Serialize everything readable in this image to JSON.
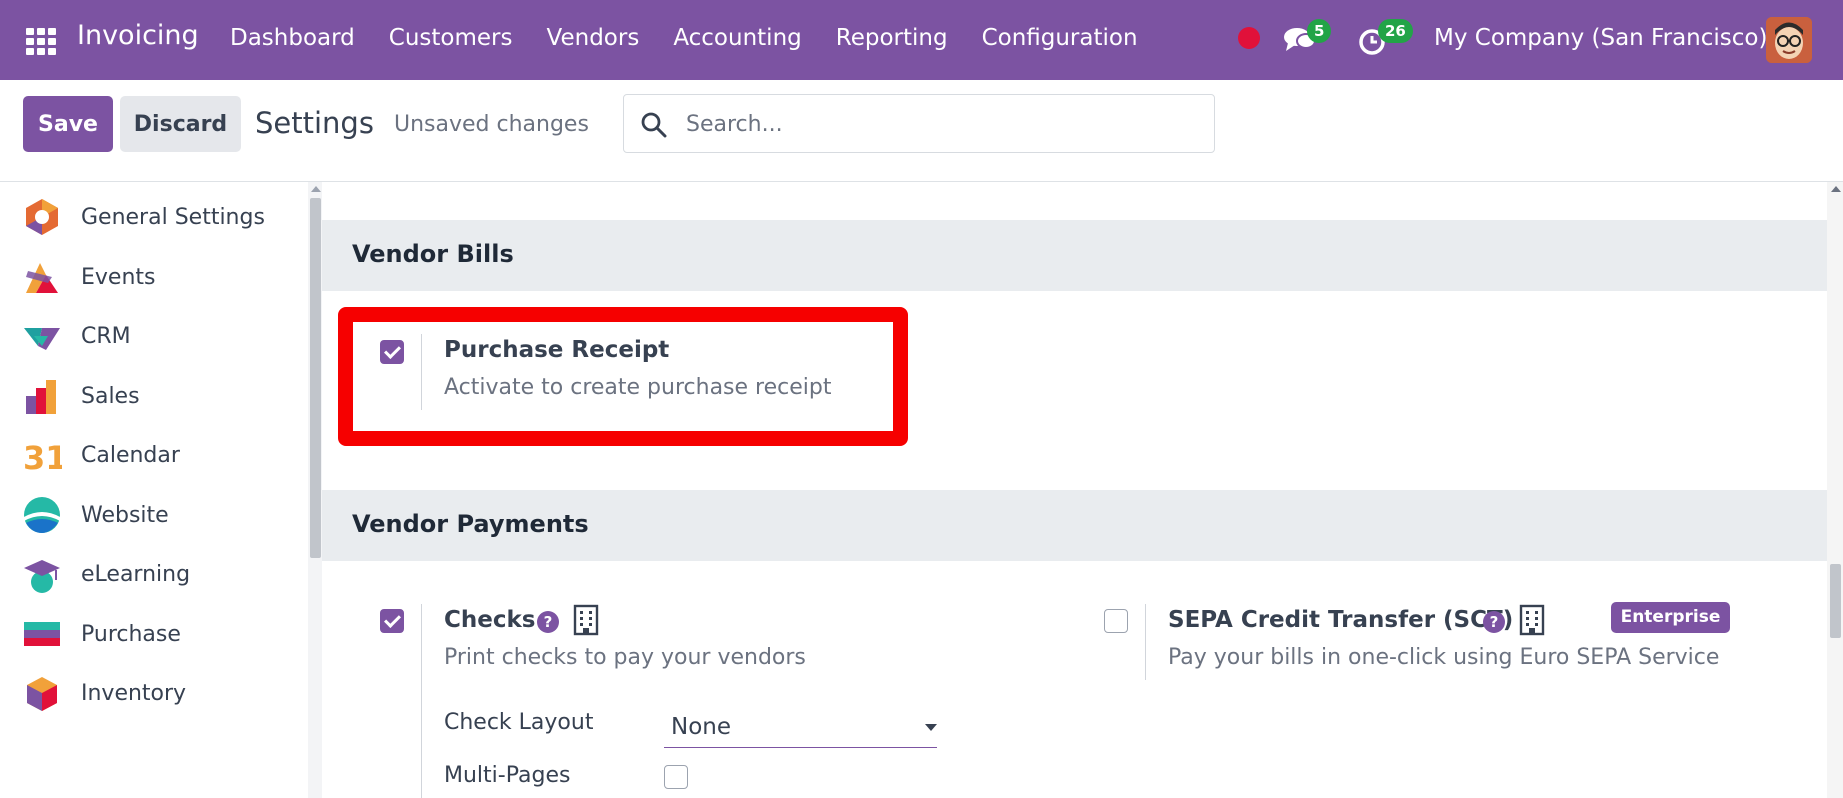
{
  "navbar": {
    "app_name": "Invoicing",
    "menu": [
      "Dashboard",
      "Customers",
      "Vendors",
      "Accounting",
      "Reporting",
      "Configuration"
    ],
    "messages_count": "5",
    "activities_count": "26",
    "company": "My Company (San Francisco)",
    "status_color": "#e1113a"
  },
  "control": {
    "save_label": "Save",
    "discard_label": "Discard",
    "title": "Settings",
    "unsaved": "Unsaved changes",
    "search_placeholder": "Search..."
  },
  "sidebar": {
    "items": [
      {
        "label": "General Settings",
        "icon": "general-settings-icon"
      },
      {
        "label": "Events",
        "icon": "events-icon"
      },
      {
        "label": "CRM",
        "icon": "crm-icon"
      },
      {
        "label": "Sales",
        "icon": "sales-icon"
      },
      {
        "label": "Calendar",
        "icon": "calendar-icon",
        "glyph": "31"
      },
      {
        "label": "Website",
        "icon": "website-icon"
      },
      {
        "label": "eLearning",
        "icon": "elearning-icon"
      },
      {
        "label": "Purchase",
        "icon": "purchase-icon"
      },
      {
        "label": "Inventory",
        "icon": "inventory-icon"
      }
    ]
  },
  "vendor_bills": {
    "title": "Vendor Bills",
    "purchase_receipt": {
      "title": "Purchase Receipt",
      "description": "Activate to create purchase receipt",
      "checked": true
    }
  },
  "vendor_payments": {
    "title": "Vendor Payments",
    "checks": {
      "title": "Checks",
      "description": "Print checks to pay your vendors",
      "checked": true,
      "check_layout_label": "Check Layout",
      "check_layout_value": "None",
      "multi_pages_label": "Multi-Pages"
    },
    "sepa": {
      "title": "SEPA Credit Transfer (SCT)",
      "description": "Pay your bills in one-click using Euro SEPA Service",
      "checked": false,
      "badge": "Enterprise"
    },
    "help_glyph": "?"
  },
  "colors": {
    "brand": "#7c53a2",
    "highlight": "#f60000",
    "badge_green": "#22a447"
  }
}
